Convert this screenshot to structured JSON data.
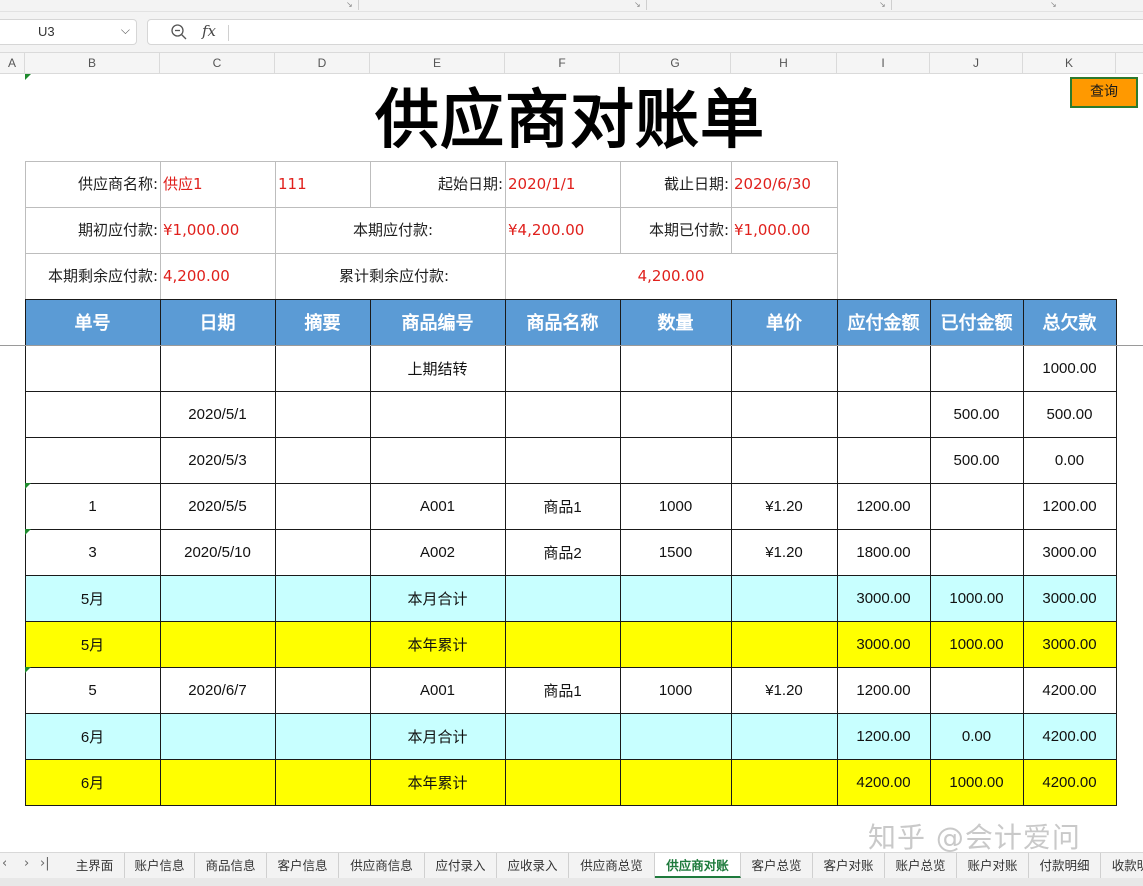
{
  "formula_bar": {
    "name_box": "U3",
    "fx_label": "fx",
    "formula": ""
  },
  "columns": [
    "A",
    "B",
    "C",
    "D",
    "E",
    "F",
    "G",
    "H",
    "I",
    "J",
    "K"
  ],
  "title": "供应商对账单",
  "query_button": "查询",
  "info": {
    "supplier_label": "供应商名称:",
    "supplier_value": "供应1",
    "supplier_code": "111",
    "start_label": "起始日期:",
    "start_value": "2020/1/1",
    "end_label": "截止日期:",
    "end_value": "2020/6/30",
    "opening_label": "期初应付款:",
    "opening_value": "¥1,000.00",
    "period_payable_label": "本期应付款:",
    "period_payable_value": "¥4,200.00",
    "period_paid_label": "本期已付款:",
    "period_paid_value": "¥1,000.00",
    "period_remaining_label": "本期剩余应付款:",
    "period_remaining_value": "4,200.00",
    "cumulative_remaining_label": "累计剩余应付款:",
    "cumulative_remaining_value": "4,200.00"
  },
  "table": {
    "headers": [
      "单号",
      "日期",
      "摘要",
      "商品编号",
      "商品名称",
      "数量",
      "单价",
      "应付金额",
      "已付金额",
      "总欠款"
    ],
    "rows": [
      {
        "style": "normal",
        "cells": [
          "",
          "",
          "",
          "上期结转",
          "",
          "",
          "",
          "",
          "",
          "1000.00"
        ]
      },
      {
        "style": "normal",
        "cells": [
          "",
          "2020/5/1",
          "",
          "",
          "",
          "",
          "",
          "",
          "500.00",
          "500.00"
        ]
      },
      {
        "style": "normal",
        "cells": [
          "",
          "2020/5/3",
          "",
          "",
          "",
          "",
          "",
          "",
          "500.00",
          "0.00"
        ]
      },
      {
        "style": "normal",
        "cells": [
          "1",
          "2020/5/5",
          "",
          "A001",
          "商品1",
          "1000",
          "¥1.20",
          "1200.00",
          "",
          "1200.00"
        ]
      },
      {
        "style": "normal",
        "cells": [
          "3",
          "2020/5/10",
          "",
          "A002",
          "商品2",
          "1500",
          "¥1.20",
          "1800.00",
          "",
          "3000.00"
        ]
      },
      {
        "style": "cyan",
        "cells": [
          "5月",
          "",
          "",
          "本月合计",
          "",
          "",
          "",
          "3000.00",
          "1000.00",
          "3000.00"
        ]
      },
      {
        "style": "yellow",
        "cells": [
          "5月",
          "",
          "",
          "本年累计",
          "",
          "",
          "",
          "3000.00",
          "1000.00",
          "3000.00"
        ]
      },
      {
        "style": "normal",
        "cells": [
          "5",
          "2020/6/7",
          "",
          "A001",
          "商品1",
          "1000",
          "¥1.20",
          "1200.00",
          "",
          "4200.00"
        ]
      },
      {
        "style": "cyan",
        "cells": [
          "6月",
          "",
          "",
          "本月合计",
          "",
          "",
          "",
          "1200.00",
          "0.00",
          "4200.00"
        ]
      },
      {
        "style": "yellow",
        "cells": [
          "6月",
          "",
          "",
          "本年累计",
          "",
          "",
          "",
          "4200.00",
          "1000.00",
          "4200.00"
        ]
      }
    ]
  },
  "watermark": "知乎 @会计爱问",
  "sheet_tabs": [
    "主界面",
    "账户信息",
    "商品信息",
    "客户信息",
    "供应商信息",
    "应付录入",
    "应收录入",
    "供应商总览",
    "供应商对账",
    "客户总览",
    "客户对账",
    "账户总览",
    "账户对账",
    "付款明细",
    "收款明"
  ],
  "active_tab": "供应商对账",
  "colors": {
    "header_blue": "#5b9bd5",
    "month_total": "#c8ffff",
    "year_total": "#ffff00",
    "query_button": "#ff9900",
    "highlight_text": "#e0201c",
    "active_tab": "#1e7a3c"
  }
}
